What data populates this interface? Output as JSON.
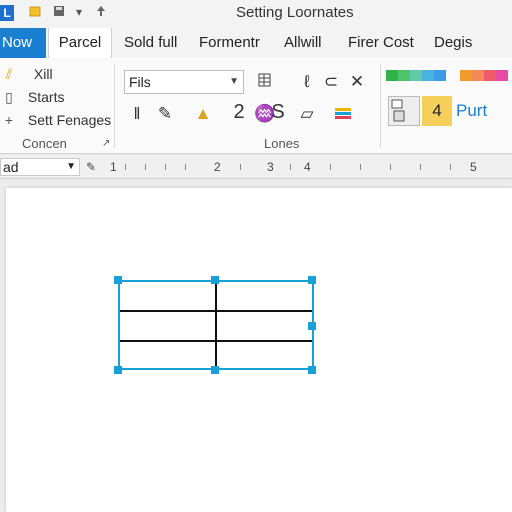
{
  "window": {
    "title": "Setting Loornates",
    "app_logo": "L",
    "quick_access": [
      "folder-icon",
      "save-icon",
      "chevron-down-icon",
      "pin-icon"
    ]
  },
  "tabs": [
    {
      "label": "Now",
      "type": "file"
    },
    {
      "label": "Parcel",
      "active": true
    },
    {
      "label": "Sold full"
    },
    {
      "label": "Formentr"
    },
    {
      "label": "Allwill"
    },
    {
      "label": "Firer Cost"
    },
    {
      "label": "Degis"
    }
  ],
  "ribbon": {
    "group1": {
      "items": [
        "Xill",
        "Starts",
        "Sett Fenages"
      ],
      "label": "Concen",
      "launcher": "↗"
    },
    "group2": {
      "font_value": "Fils",
      "label": "Lones",
      "tool_number": "2",
      "tool_letter": "S"
    },
    "styles": {
      "number": "4",
      "name": "Purt",
      "swatches_top": [
        "#2fb24a",
        "#4fc36a",
        "#5fc9a8",
        "#4ab2e0",
        "#3c9ae6",
        "#f19b2b",
        "#f28a57",
        "#ef5b6b",
        "#e64aa2",
        "#f27fd3"
      ]
    }
  },
  "ruler": {
    "field_value": "ad",
    "marks": [
      "1",
      "2",
      "3",
      "4",
      "5"
    ]
  },
  "colors": {
    "accent": "#1b7fd1",
    "selection": "#1aa0d8"
  }
}
